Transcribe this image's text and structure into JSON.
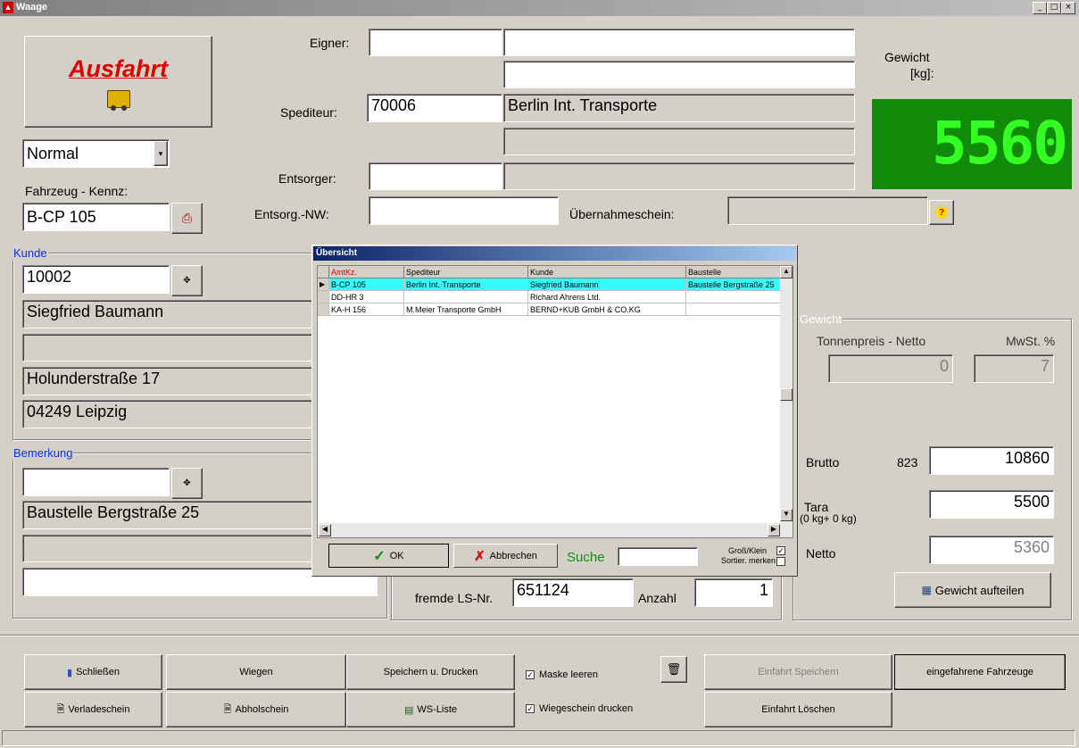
{
  "window": {
    "title": "Waage",
    "min": "_",
    "max": "□",
    "close": "×"
  },
  "mode_button": {
    "label": "Ausfahrt"
  },
  "mode_select": {
    "value": "Normal"
  },
  "vehicle": {
    "label": "Fahrzeug - Kennz:",
    "value": "B-CP 105"
  },
  "header": {
    "eigner_label": "Eigner:",
    "eigner_code": "",
    "eigner_name1": "",
    "eigner_name2": "",
    "spediteur_label": "Spediteur:",
    "spediteur_code": "70006",
    "spediteur_name": "Berlin Int. Transporte",
    "spediteur_name2": "",
    "entsorger_label": "Entsorger:",
    "entsorger_code": "",
    "entsorger_name": "",
    "entsorg_nw_label": "Entsorg.-NW:",
    "entsorg_nw_value": "",
    "uebernahme_label": "Übernahmeschein:",
    "uebernahme_value": ""
  },
  "weight_display": {
    "label1": "Gewicht",
    "label2": "[kg]:",
    "value": "5560"
  },
  "kunde": {
    "group_label": "Kunde",
    "code": "10002",
    "name": "Siegfried Baumann",
    "line2": "",
    "street": "Holunderstraße 17",
    "city": "04249 Leipzig"
  },
  "bemerkung": {
    "group_label": "Bemerkung",
    "code": "",
    "line1": "Baustelle Bergstraße 25",
    "line2": "",
    "line3": ""
  },
  "gewicht": {
    "group_label": "Gewicht",
    "tonnenpreis_label": "Tonnenpreis - Netto",
    "tonnenpreis_value": "0",
    "mwst_label": "MwSt. %",
    "mwst_value": "7",
    "brutto_label": "Brutto",
    "brutto_small": "823",
    "brutto_value": "10860",
    "tara_label": "Tara",
    "tara_sub": "(0 kg+ 0 kg)",
    "tara_value": "5500",
    "netto_label": "Netto",
    "netto_value": "5360",
    "split_button": "Gewicht aufteilen"
  },
  "ls": {
    "label": "fremde LS-Nr.",
    "value": "651124",
    "anzahl_label": "Anzahl",
    "anzahl_value": "1"
  },
  "dialog": {
    "title": "Übersicht",
    "columns": [
      "AmtKz.",
      "Spediteur",
      "Kunde",
      "Baustelle"
    ],
    "rows": [
      [
        "B-CP 105",
        "Berlin Int. Transporte",
        "Siegfried Baumann",
        "Baustelle Bergstraße 25"
      ],
      [
        "DD-HR 3",
        "",
        "Richard Ahrens Ltd.",
        ""
      ],
      [
        "KA-H 156",
        "M.Meier Transporte GmbH",
        "BERND+KUB GmbH & CO.KG",
        ""
      ]
    ],
    "ok_label": "OK",
    "cancel_label": "Abbrechen",
    "search_label": "Suche",
    "search_value": "",
    "grossklein_label": "Groß/Klein",
    "sortier_label": "Sortier. merken"
  },
  "bottom": {
    "schliessen": "Schließen",
    "wiegen": "Wiegen",
    "speichern_drucken": "Speichern u. Drucken",
    "maske_leeren": "Maske leeren",
    "einfahrt_speichern": "Einfahrt Speichern",
    "eingefahrene": "eingefahrene Fahrzeuge",
    "verladeschein": "Verladeschein",
    "abholschein": "Abholschein",
    "ws_liste": "WS-Liste",
    "wiegeschein_drucken": "Wiegeschein drucken",
    "einfahrt_loeschen": "Einfahrt Löschen"
  },
  "colors": {
    "accent_red": "#e00000",
    "display_bg": "#108a08",
    "display_fg": "#33ff22",
    "group_label": "#1030e0",
    "selected_row": "#33ffff"
  }
}
